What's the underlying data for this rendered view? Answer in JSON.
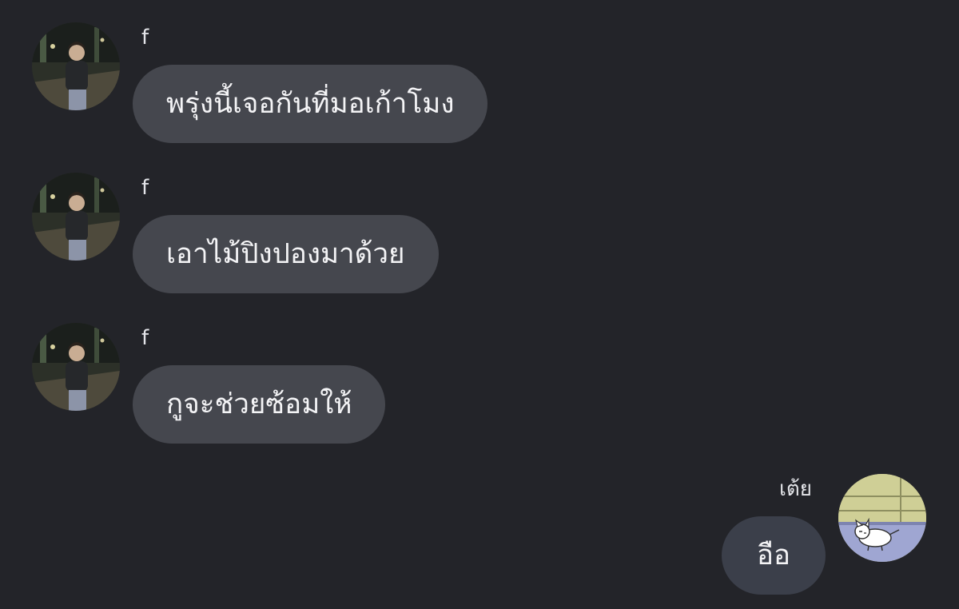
{
  "messages": [
    {
      "sender": "f",
      "text": "พรุ่งนี้เจอกันที่มอเก้าโมง",
      "avatar": "person-night-street-photo"
    },
    {
      "sender": "f",
      "text": "เอาไม้ปิงปองมาด้วย",
      "avatar": "person-night-street-photo"
    },
    {
      "sender": "f",
      "text": "กูจะช่วยซ้อมให้",
      "avatar": "person-night-street-photo"
    },
    {
      "sender": "เต้ย",
      "text": "อือ",
      "avatar": "cartoon-dog-sticker"
    }
  ],
  "colors": {
    "background": "#232429",
    "incoming_bubble": "#45474e",
    "outgoing_bubble": "#3b3f4a",
    "text": "#f4f4f6"
  }
}
